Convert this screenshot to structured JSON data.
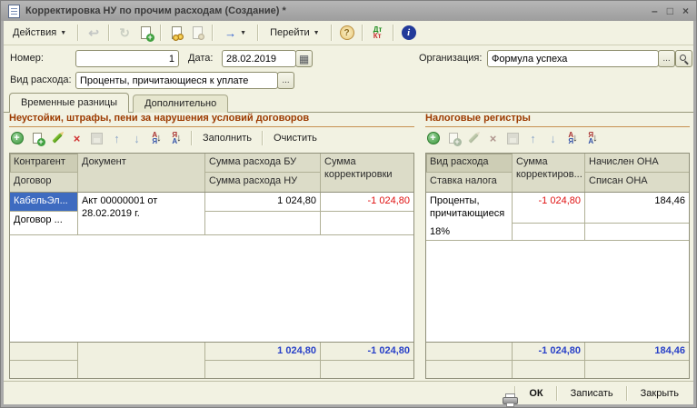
{
  "window": {
    "title": "Корректировка НУ по прочим расходам (Создание) *",
    "min": "–",
    "max": "□",
    "close": "×"
  },
  "toolbar": {
    "actions": "Действия",
    "goto": "Перейти",
    "dropdown": "▼"
  },
  "glyphs": {
    "back": "↩",
    "refresh": "↻",
    "out_arrow": "→",
    "question": "?",
    "dt": "Дт",
    "kt": "Кт",
    "info": "i",
    "calendar": "▦",
    "plus": "+",
    "cross": "×",
    "up": "↑",
    "down": "↓",
    "a": "А",
    "ya": "Я",
    "sort_down": "↓",
    "ellipsis": "..."
  },
  "fields": {
    "number_label": "Номер:",
    "number_value": "1",
    "date_label": "Дата:",
    "date_value": "28.02.2019",
    "kind_label": "Вид расхода:",
    "kind_value": "Проценты, причитающиеся к уплате",
    "org_label": "Организация:",
    "org_value": "Формула успеха"
  },
  "tabs": {
    "t1": "Временные разницы",
    "t2": "Дополнительно"
  },
  "left": {
    "title": "Неустойки, штрафы, пени за нарушения условий договоров",
    "fill": "Заполнить",
    "clear": "Очистить",
    "cols": {
      "c1a": "Контрагент",
      "c1b": "Договор",
      "c2": "Документ",
      "c3a": "Сумма расхода БУ",
      "c3b": "Сумма расхода НУ",
      "c4": "Сумма корректировки"
    },
    "row": {
      "c1a": "КабельЭл...",
      "c1b": "Договор ...",
      "c2": "Акт 00000001 от 28.02.2019 г.",
      "c3a": "1 024,80",
      "c4a": "-1 024,80"
    },
    "totals": {
      "c3": "1 024,80",
      "c4": "-1 024,80"
    }
  },
  "right": {
    "title": "Налоговые регистры",
    "cols": {
      "c1a": "Вид расхода",
      "c1b": "Ставка налога",
      "c2": "Сумма корректиров...",
      "c3a": "Начислен ОНА",
      "c3b": "Списан ОНА"
    },
    "row": {
      "c1a": "Проценты, причитающиеся ...",
      "c1b": "18%",
      "c2": "-1 024,80",
      "c3a": "184,46"
    },
    "totals": {
      "c2": "-1 024,80",
      "c3": "184,46"
    }
  },
  "footer": {
    "ok": "ОК",
    "save": "Записать",
    "close": "Закрыть"
  }
}
